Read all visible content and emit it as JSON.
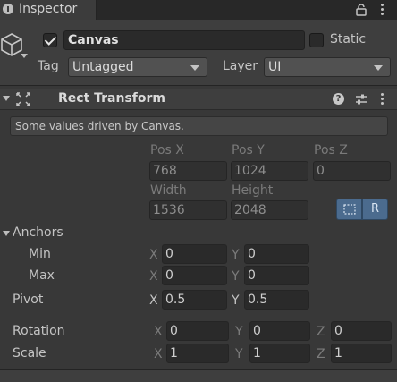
{
  "tab": {
    "label": "Inspector"
  },
  "gameobject": {
    "active": true,
    "name": "Canvas",
    "static_label": "Static",
    "tag_label": "Tag",
    "tag_value": "Untagged",
    "layer_label": "Layer",
    "layer_value": "UI"
  },
  "rect_transform": {
    "title": "Rect Transform",
    "note": "Some values driven by Canvas.",
    "pos_headers": [
      "Pos X",
      "Pos Y",
      "Pos Z"
    ],
    "pos_values": [
      "768",
      "1024",
      "0"
    ],
    "size_headers": [
      "Width",
      "Height"
    ],
    "size_values": [
      "1536",
      "2048"
    ],
    "raw_button": "R",
    "anchors_label": "Anchors",
    "min_label": "Min",
    "min": {
      "x": "0",
      "y": "0"
    },
    "max_label": "Max",
    "max": {
      "x": "0",
      "y": "0"
    },
    "pivot_label": "Pivot",
    "pivot": {
      "x": "0.5",
      "y": "0.5"
    },
    "rotation_label": "Rotation",
    "rotation": {
      "x": "0",
      "y": "0",
      "z": "0"
    },
    "scale_label": "Scale",
    "scale": {
      "x": "1",
      "y": "1",
      "z": "1"
    },
    "axes": {
      "x": "X",
      "y": "Y",
      "z": "Z"
    }
  },
  "colors": {
    "accent": "#4b6b8e",
    "background": "#383838"
  },
  "icons": [
    "info-icon",
    "lock-icon",
    "kebab-menu-icon",
    "gameobject-cube-icon",
    "rect-transform-icon",
    "help-icon",
    "settings-sliders-icon",
    "blueprint-mode-icon"
  ]
}
